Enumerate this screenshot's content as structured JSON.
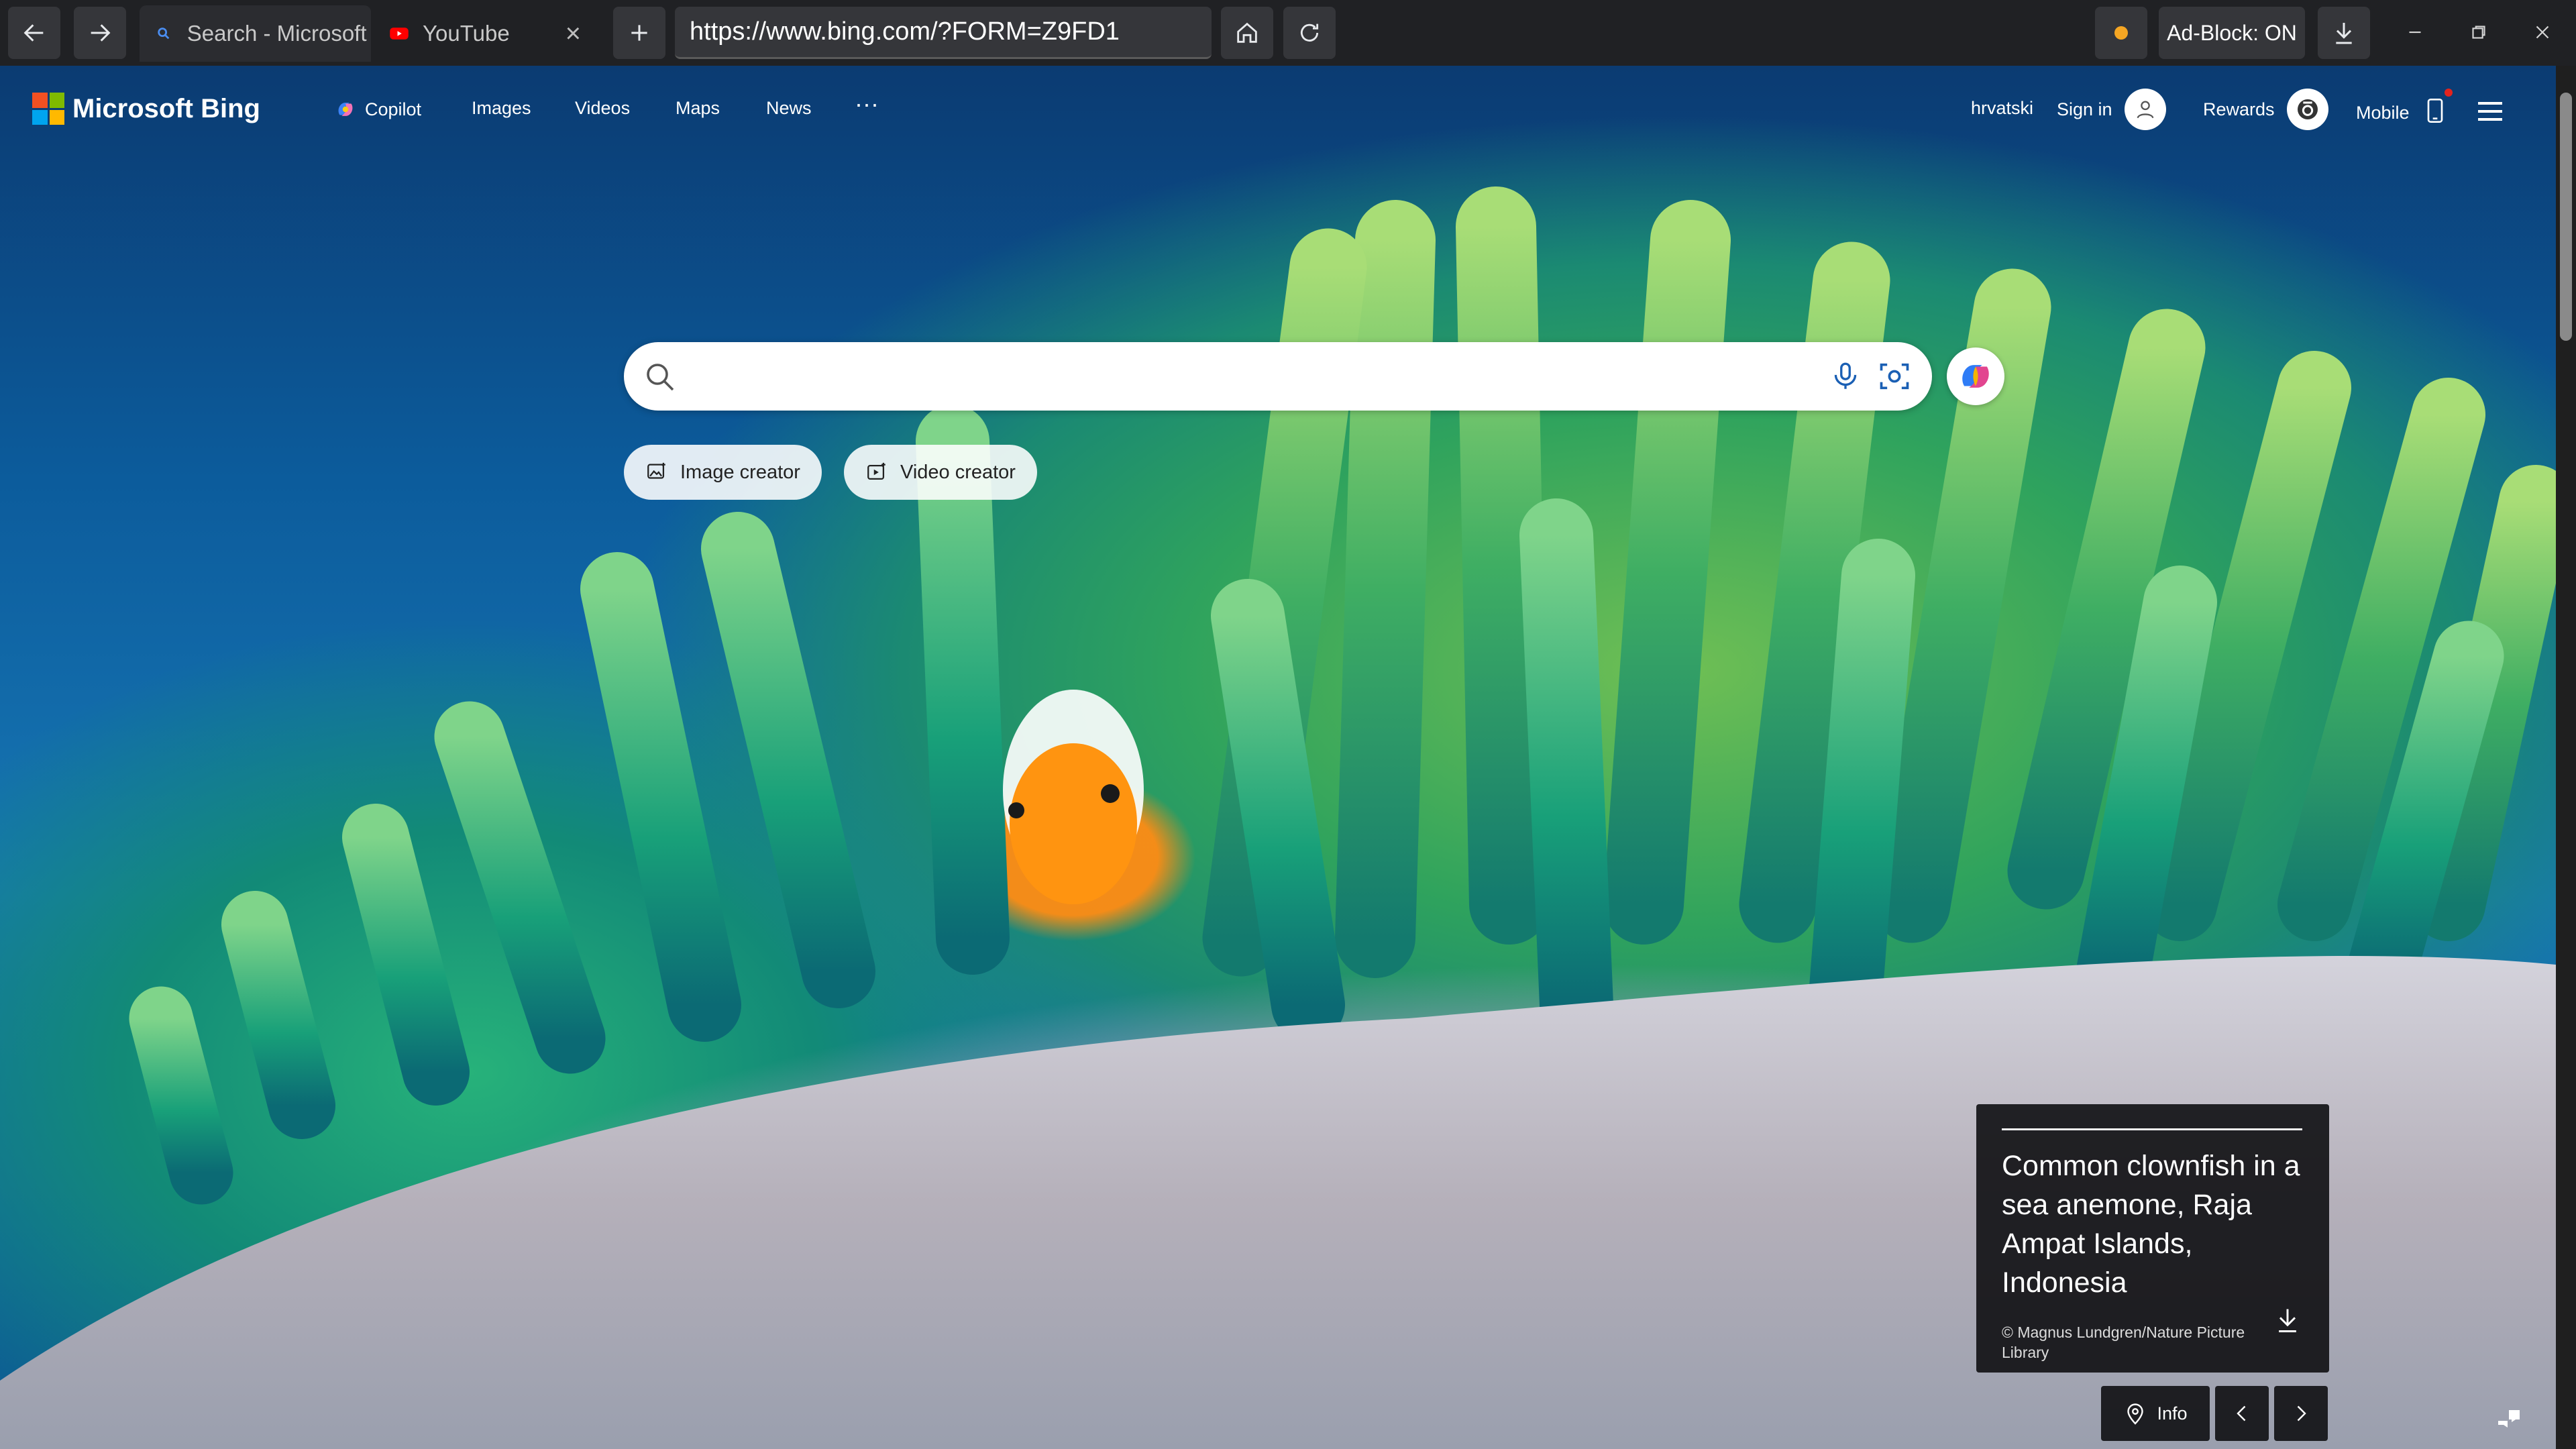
{
  "browser": {
    "tabs": [
      {
        "title": "Search - Microsoft I",
        "icon": "search-icon",
        "active": true
      },
      {
        "title": "YouTube",
        "icon": "youtube-icon",
        "active": false
      }
    ],
    "url": "https://www.bing.com/?FORM=Z9FD1",
    "adblock_label": "Ad-Block: ON"
  },
  "bing": {
    "logo_text": "Microsoft Bing",
    "nav": [
      {
        "label": "Copilot"
      },
      {
        "label": "Images"
      },
      {
        "label": "Videos"
      },
      {
        "label": "Maps"
      },
      {
        "label": "News"
      },
      {
        "label": "···"
      }
    ],
    "language": "hrvatski",
    "sign_in": "Sign in",
    "rewards": "Rewards",
    "mobile": "Mobile",
    "search_placeholder": "",
    "quick_actions": [
      {
        "label": "Image creator"
      },
      {
        "label": "Video creator"
      }
    ],
    "image_info": {
      "caption": "Common clownfish in a sea anemone, Raja Ampat Islands, Indonesia",
      "credit": "© Magnus Lundgren/Nature Picture Library",
      "info_label": "Info"
    }
  },
  "colors": {
    "chrome_bg": "#202124",
    "chrome_button": "#35363a",
    "ocean_blue": "#0c5c9c",
    "card_bg": "#121216"
  }
}
